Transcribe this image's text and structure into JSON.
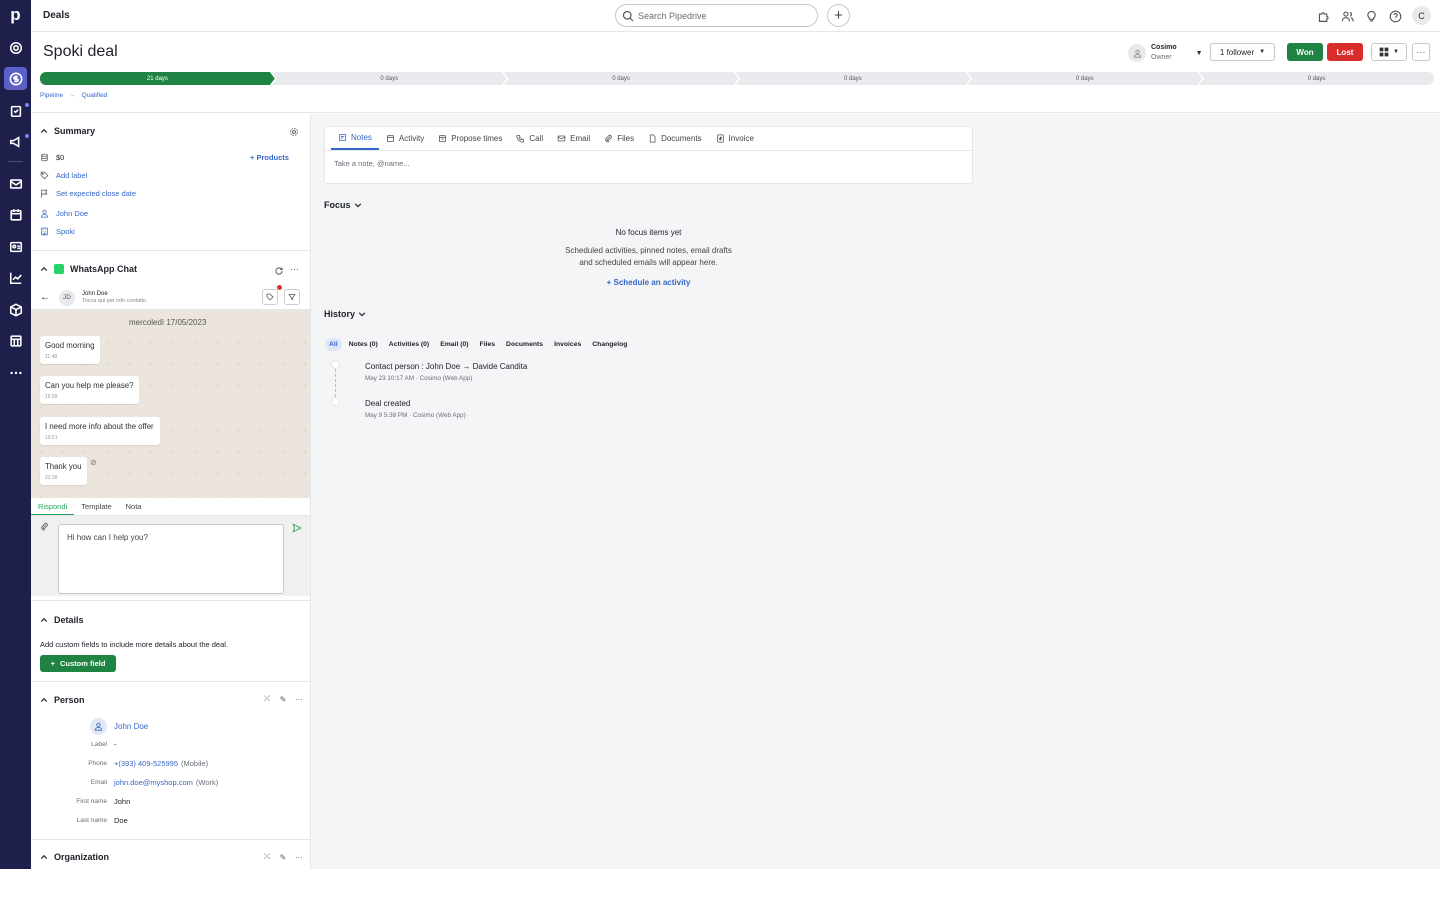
{
  "topbar": {
    "title": "Deals",
    "search_placeholder": "Search Pipedrive",
    "add_label": "+",
    "user_initial": "C"
  },
  "nav": {
    "logo": "p",
    "items": [
      "target-icon",
      "dollar-icon",
      "clipboard-icon",
      "megaphone-icon",
      "mail-icon",
      "calendar-icon",
      "contacts-icon",
      "chart-icon",
      "box-icon",
      "store-icon",
      "more-icon"
    ]
  },
  "deal": {
    "title": "Spoki deal",
    "owner_name": "Cosimo",
    "owner_role": "Owner",
    "follower_label": "1 follower",
    "won_label": "Won",
    "lost_label": "Lost",
    "more_label": "···",
    "stages": [
      {
        "label": "21 days",
        "done": true
      },
      {
        "label": "0 days",
        "done": false
      },
      {
        "label": "0 days",
        "done": false
      },
      {
        "label": "0 days",
        "done": false
      },
      {
        "label": "0 days",
        "done": false
      },
      {
        "label": "0 days",
        "done": false
      }
    ],
    "breadcrumb": {
      "pipeline": "Pipeline",
      "sep": "→",
      "stage": "Qualified"
    }
  },
  "summary": {
    "title": "Summary",
    "value": "$0",
    "products_label": "+  Products",
    "add_label": "Add label",
    "close_date": "Set expected close date",
    "person": "John Doe",
    "org": "Spoki"
  },
  "whatsapp": {
    "title": "WhatsApp Chat",
    "contact_initials": "JD",
    "contact_name": "John Doe",
    "contact_sub": "Tocca qui per info contatto",
    "date": "mercoledì 17/05/2023",
    "messages": [
      {
        "text": "Good morning",
        "time": "11:48"
      },
      {
        "text": "Can you help me please?",
        "time": "16:59"
      },
      {
        "text": "I need more info about the offer",
        "time": "19:51"
      },
      {
        "text": "Thank you",
        "time": "22:28"
      }
    ],
    "tabs": [
      "Rispondi",
      "Template",
      "Nota"
    ],
    "reply_text": "Hi how can I help you?"
  },
  "details": {
    "title": "Details",
    "hint": "Add custom fields to include more details about the deal.",
    "custom_field_label": "Custom field"
  },
  "person": {
    "title": "Person",
    "name": "John Doe",
    "label_lbl": "Label",
    "label_val": "-",
    "phone_lbl": "Phone",
    "phone_val": "+(393) 409-525995",
    "phone_type": "(Mobile)",
    "email_lbl": "Email",
    "email_val": "john.doe@myshop.com",
    "email_type": "(Work)",
    "first_lbl": "First name",
    "first_val": "John",
    "last_lbl": "Last name",
    "last_val": "Doe"
  },
  "organization": {
    "title": "Organization"
  },
  "composer": {
    "tabs": [
      "Notes",
      "Activity",
      "Propose times",
      "Call",
      "Email",
      "Files",
      "Documents",
      "Invoice"
    ],
    "placeholder": "Take a note, @name..."
  },
  "focus": {
    "title": "Focus",
    "empty": "No focus items yet",
    "sub1": "Scheduled activities, pinned notes, email drafts",
    "sub2": "and scheduled emails will appear here.",
    "schedule": "+   Schedule an activity"
  },
  "history": {
    "title": "History",
    "tabs": [
      "All",
      "Notes (0)",
      "Activities (0)",
      "Email (0)",
      "Files",
      "Documents",
      "Invoices",
      "Changelog"
    ],
    "items": [
      {
        "title": "Contact person : John Doe → Davide Candita",
        "meta": "May 23 10:17 AM · Cosimo (Web App)"
      },
      {
        "title": "Deal created",
        "meta": "May 9 5:38 PM · Cosimo (Web App)"
      }
    ]
  }
}
